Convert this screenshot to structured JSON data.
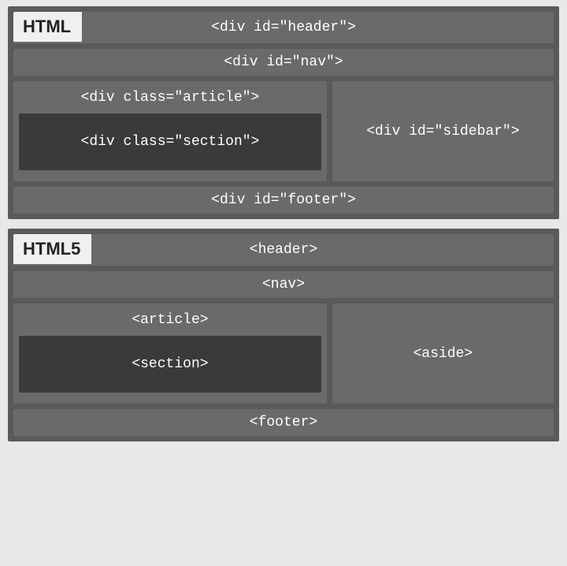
{
  "html4": {
    "title": "HTML",
    "header": "<div id=\"header\">",
    "nav": "<div id=\"nav\">",
    "article": "<div class=\"article\">",
    "section": "<div class=\"section\">",
    "sidebar": "<div id=\"sidebar\">",
    "footer": "<div id=\"footer\">"
  },
  "html5": {
    "title": "HTML5",
    "header": "<header>",
    "nav": "<nav>",
    "article": "<article>",
    "section": "<section>",
    "sidebar": "<aside>",
    "footer": "<footer>"
  }
}
